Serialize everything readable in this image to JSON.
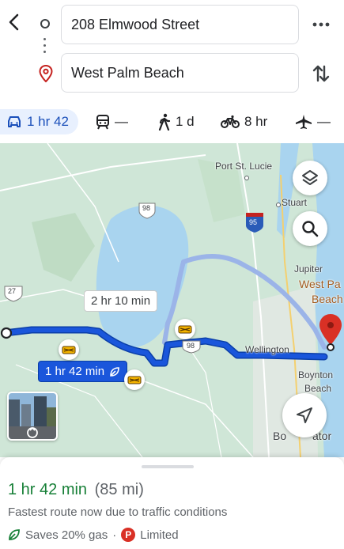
{
  "search": {
    "origin_value": "208 Elmwood Street",
    "destination_value": "West Palm Beach",
    "more_icon": "more-horizontal-icon",
    "swap_icon": "swap-vertical-icon"
  },
  "modes": {
    "car": "1 hr 42",
    "transit": "—",
    "walk": "1 d",
    "bike": "8 hr",
    "flight": "—"
  },
  "map": {
    "labels": {
      "port_st_lucie": "Port St. Lucie",
      "stuart": "Stuart",
      "jupiter": "Jupiter",
      "west_palm_1": "West Pa",
      "west_palm_2": "Beach",
      "wellington": "Wellington",
      "boynton_1": "Boynton",
      "boynton_2": "Beach",
      "boca_1": "Bo",
      "boca_2": "ator",
      "hwy_98_top": "98",
      "hwy_95": "95",
      "hwy_27": "27",
      "hwy_98_mid": "98"
    },
    "alt_route_label": "2 hr 10 min",
    "main_route_label": "1 hr 42 min",
    "colors": {
      "route_main": "#1a56db",
      "route_alt": "#9bb4e8",
      "water": "#a9d4ef",
      "land": "#cfe6d7",
      "pin": "#d93025"
    }
  },
  "sheet": {
    "time": "1 hr 42 min",
    "distance": "(85 mi)",
    "note": "Fastest route now due to traffic conditions",
    "gas": "Saves 20% gas",
    "separator": "·",
    "parking_badge": "P",
    "parking": "Limited"
  }
}
